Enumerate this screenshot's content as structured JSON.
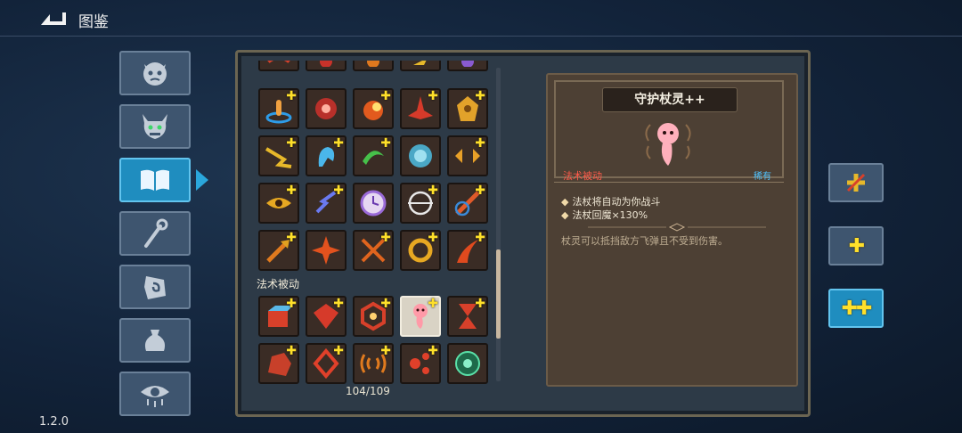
{
  "header": {
    "title": "图鉴",
    "version": "1.2.0"
  },
  "sidebar": {
    "items": [
      {
        "name": "enemies",
        "icon": "demon-face-icon"
      },
      {
        "name": "bosses",
        "icon": "horned-mask-icon"
      },
      {
        "name": "codex",
        "icon": "open-book-icon",
        "active": true
      },
      {
        "name": "weapons",
        "icon": "staff-icon"
      },
      {
        "name": "relics",
        "icon": "rune-hand-icon"
      },
      {
        "name": "items",
        "icon": "pouch-icon"
      },
      {
        "name": "curses",
        "icon": "eye-icon"
      }
    ]
  },
  "grid": {
    "section_label": "法术被动",
    "counter": "104/109",
    "selected_index": 3
  },
  "detail": {
    "name": "守护杖灵++",
    "type": "法术被动",
    "rarity": "稀有",
    "desc": [
      "法杖将自动为你战斗",
      "法杖回魔×130%"
    ],
    "flavor": "杖灵可以抵挡敌方飞弹且不受到伤害。"
  },
  "upgrade_buttons": [
    {
      "label": "",
      "icon": "broken-upgrade-icon"
    },
    {
      "label": "✚",
      "icon": "single-plus-icon"
    },
    {
      "label": "✚✚",
      "icon": "double-plus-icon",
      "active": true
    }
  ],
  "colors": {
    "accent": "#1f8dbf",
    "panel": "#2d3a47",
    "plus": "#ffe02a",
    "type": "#ff5a4a",
    "rarity": "#4fc3ff"
  }
}
